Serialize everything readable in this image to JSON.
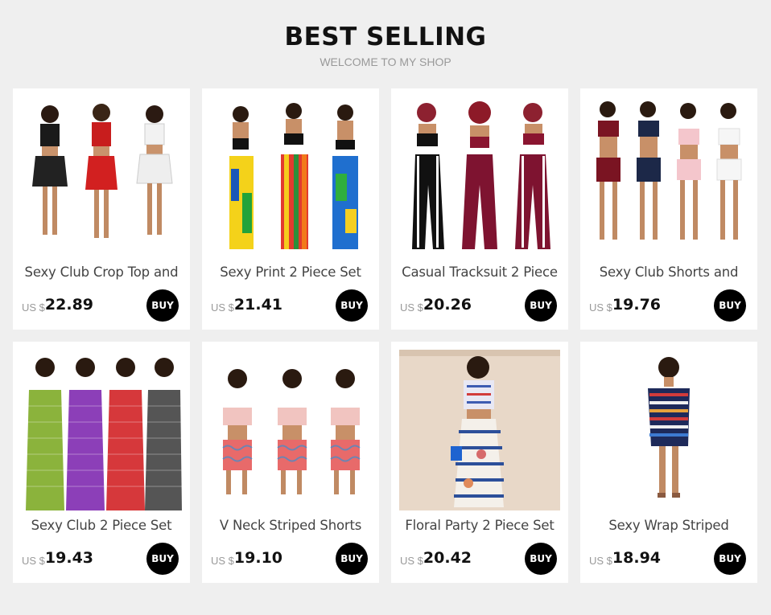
{
  "header": {
    "title": "BEST SELLING",
    "subtitle": "WELCOME TO MY SHOP"
  },
  "products": [
    {
      "name": "Sexy Club Crop Top and",
      "currency": "US $",
      "price": "22.89",
      "buy_label": "BUY",
      "image": "product-photo-icon"
    },
    {
      "name": "Sexy Print 2 Piece Set",
      "currency": "US $",
      "price": "21.41",
      "buy_label": "BUY",
      "image": "product-photo-icon"
    },
    {
      "name": "Casual Tracksuit 2 Piece",
      "currency": "US $",
      "price": "20.26",
      "buy_label": "BUY",
      "image": "product-photo-icon"
    },
    {
      "name": "Sexy Club Shorts and",
      "currency": "US $",
      "price": "19.76",
      "buy_label": "BUY",
      "image": "product-photo-icon"
    },
    {
      "name": "Sexy Club 2 Piece Set",
      "currency": "US $",
      "price": "19.43",
      "buy_label": "BUY",
      "image": "product-photo-icon"
    },
    {
      "name": "V Neck Striped Shorts",
      "currency": "US $",
      "price": "19.10",
      "buy_label": "BUY",
      "image": "product-photo-icon"
    },
    {
      "name": "Floral Party 2 Piece Set",
      "currency": "US $",
      "price": "20.42",
      "buy_label": "BUY",
      "image": "product-photo-icon"
    },
    {
      "name": "Sexy Wrap Striped",
      "currency": "US $",
      "price": "18.94",
      "buy_label": "BUY",
      "image": "product-photo-icon"
    }
  ]
}
